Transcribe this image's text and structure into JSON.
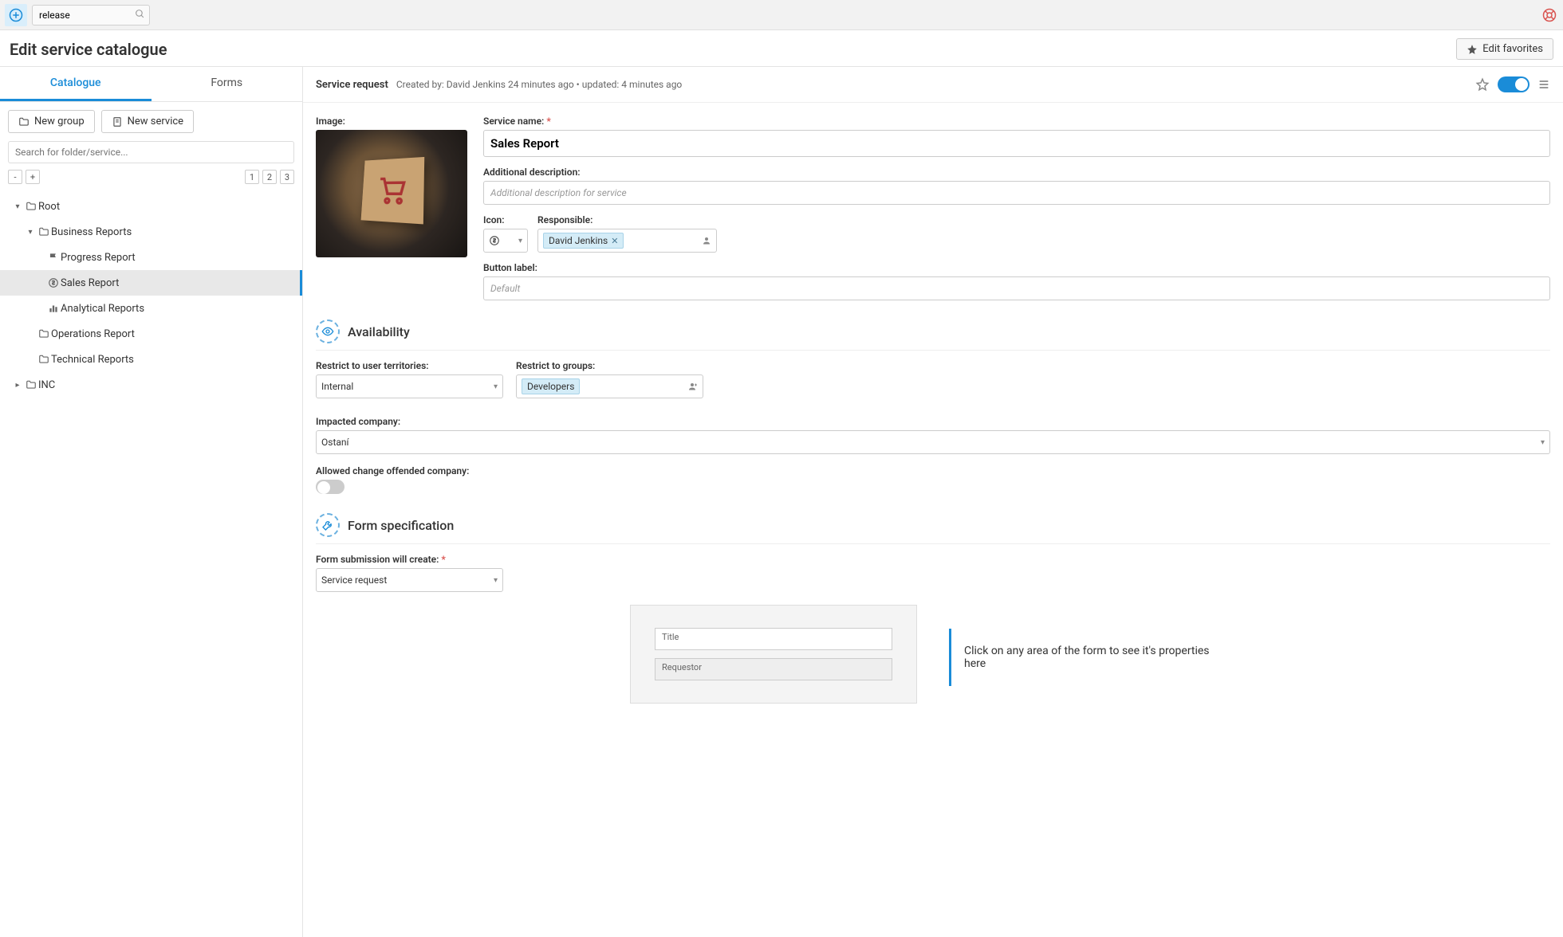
{
  "topbar": {
    "search_value": "release"
  },
  "header": {
    "title": "Edit service catalogue",
    "edit_favorites": "Edit favorites"
  },
  "tabs": {
    "catalogue": "Catalogue",
    "forms": "Forms"
  },
  "sidebar": {
    "new_group": "New group",
    "new_service": "New service",
    "search_placeholder": "Search for folder/service...",
    "levels": {
      "minus": "-",
      "plus": "+",
      "l1": "1",
      "l2": "2",
      "l3": "3"
    },
    "tree": {
      "root": "Root",
      "business_reports": "Business Reports",
      "progress_report": "Progress Report",
      "sales_report": "Sales Report",
      "analytical_reports": "Analytical Reports",
      "operations_report": "Operations Report",
      "technical_reports": "Technical Reports",
      "inc": "INC"
    }
  },
  "content_header": {
    "type": "Service request",
    "created_by_prefix": "Created by: ",
    "created_by": "David Jenkins",
    "created_ago": "24 minutes ago",
    "updated_prefix": " • updated: ",
    "updated_ago": "4 minutes ago"
  },
  "form": {
    "image_label": "Image:",
    "service_name_label": "Service name:",
    "service_name_value": "Sales Report",
    "add_desc_label": "Additional description:",
    "add_desc_placeholder": "Additional description for service",
    "icon_label": "Icon:",
    "responsible_label": "Responsible:",
    "responsible_value": "David Jenkins",
    "button_label_label": "Button label:",
    "button_label_placeholder": "Default"
  },
  "availability": {
    "title": "Availability",
    "restrict_territories_label": "Restrict to user territories:",
    "restrict_territories_value": "Internal",
    "restrict_groups_label": "Restrict to groups:",
    "restrict_groups_value": "Developers",
    "impacted_company_label": "Impacted company:",
    "impacted_company_value": "Ostaní",
    "allowed_change_label": "Allowed change offended company:"
  },
  "formspec": {
    "title": "Form specification",
    "create_label": "Form submission will create:",
    "create_value": "Service request",
    "preview_title": "Title",
    "preview_requestor": "Requestor",
    "hint": "Click on any area of the form to see it's properties here"
  }
}
